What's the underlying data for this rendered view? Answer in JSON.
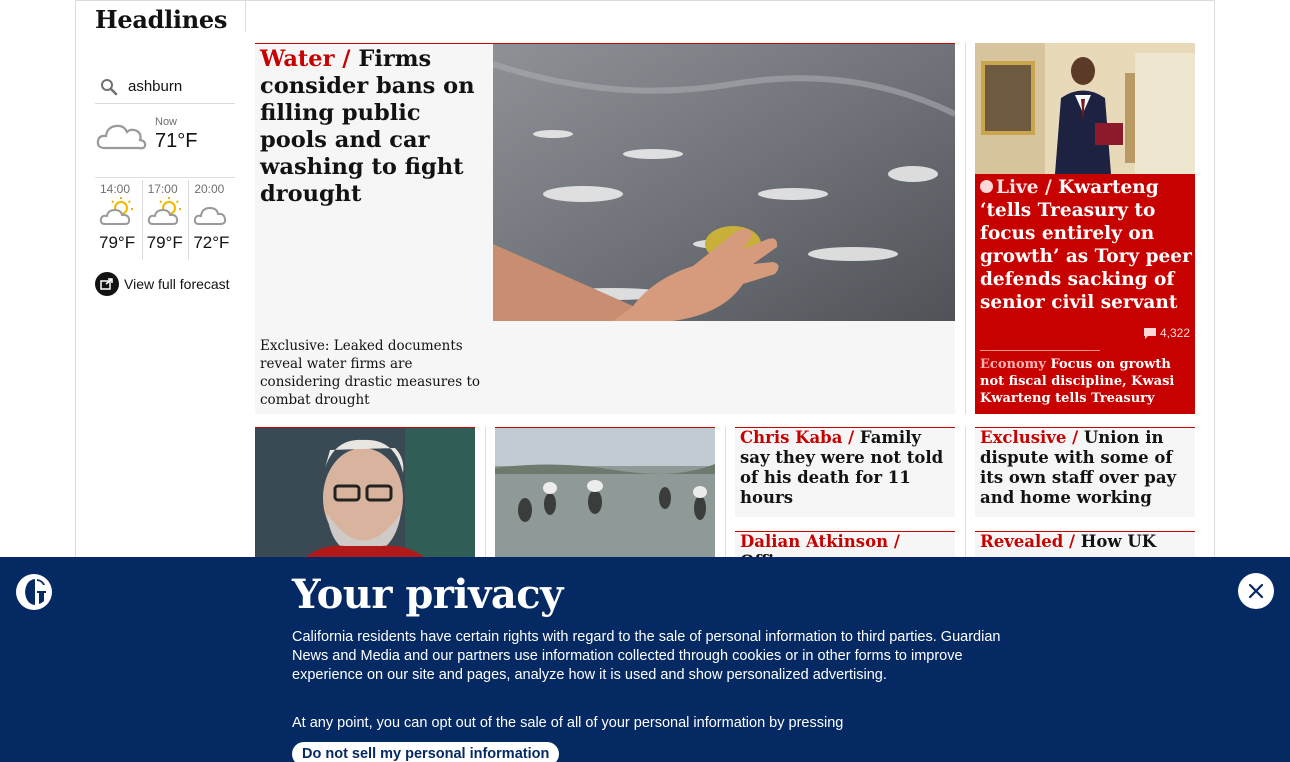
{
  "section": {
    "title": "Headlines"
  },
  "weather": {
    "location": "ashburn",
    "now_label": "Now",
    "now_temp": "71°F",
    "now_icon": "cloud-icon",
    "forecast": [
      {
        "time": "14:00",
        "temp": "79°F",
        "icon": "partly-sunny-icon"
      },
      {
        "time": "17:00",
        "temp": "79°F",
        "icon": "partly-sunny-icon"
      },
      {
        "time": "20:00",
        "temp": "72°F",
        "icon": "cloud-icon"
      }
    ],
    "link_label": "View full forecast"
  },
  "feature": {
    "kicker": "Water /",
    "headline": " Firms consider bans on filling public pools and car washing to fight drought",
    "standfirst": "Exclusive: Leaked documents reveal water firms are considering drastic measures to combat drought"
  },
  "live_card": {
    "kicker": "Live /",
    "headline": " Kwarteng ‘tells Treasury to focus entirely on growth’ as Tory peer defends sacking of senior civil servant",
    "comment_count": "4,322",
    "sub_kicker": "Economy",
    "sub_headline": " Focus on growth not fiscal discipline, Kwasi Kwarteng tells Treasury"
  },
  "cards": [
    {
      "kicker": "Chris Kaba /",
      "headline": " Family say they were not told of his death for 11 hours"
    },
    {
      "kicker": "Exclusive /",
      "headline": " Union in dispute with some of its own staff over pay and home working"
    },
    {
      "kicker": "Dalian Atkinson /",
      "headline": " Officer"
    },
    {
      "kicker": "Revealed /",
      "headline": " How UK"
    }
  ],
  "privacy": {
    "title": "Your privacy",
    "body": "California residents have certain rights with regard to the sale of personal information to third parties. Guardian News and Media and our partners use information collected through cookies or in other forms to improve experience on our site and pages, analyze how it is used and show personalized advertising.",
    "body2": "At any point, you can opt out of the sale of all of your personal information by pressing",
    "button": "Do not sell my personal information"
  },
  "colors": {
    "accent_red": "#c70000",
    "brand_blue": "#052962",
    "card_bg": "#f6f6f6"
  }
}
